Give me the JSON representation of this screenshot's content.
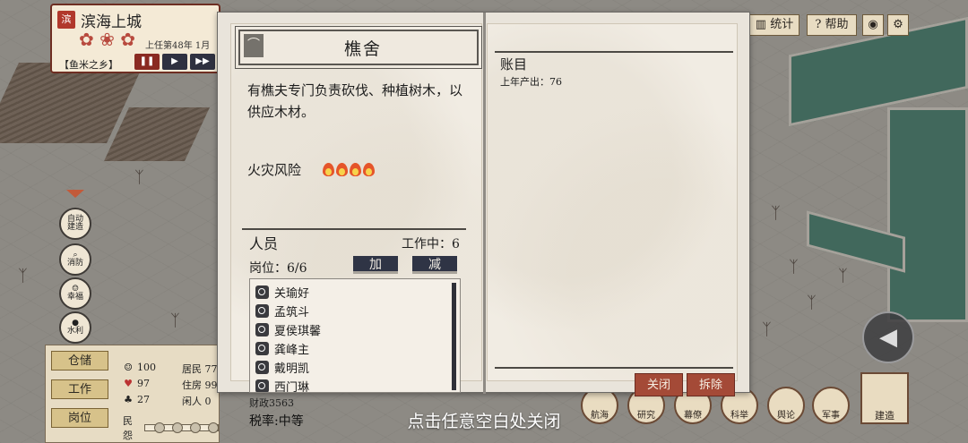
{
  "city": {
    "name": "滨海上城",
    "seal": "滨",
    "term": "上任第48年 1月",
    "tag": "【鱼米之乡】",
    "speed": [
      "❚❚",
      "▶",
      "▶▶"
    ]
  },
  "left_tools": [
    {
      "label": "自动\n建造"
    },
    {
      "label": "消防"
    },
    {
      "label": "幸福"
    },
    {
      "label": "水利"
    }
  ],
  "bottom_left": {
    "buttons": [
      "仓储",
      "工作",
      "岗位"
    ],
    "stats": [
      {
        "icon": "☺",
        "value": "100"
      },
      {
        "icon": "♥",
        "value": "97"
      },
      {
        "icon": "♣",
        "value": "27"
      }
    ],
    "stats_right": [
      "居民 77",
      "住房 99",
      "闲人 0"
    ],
    "mood_label": "民怨"
  },
  "finance": {
    "label": "财政3563",
    "tax": "税率:中等"
  },
  "top_right": {
    "stats": "统计",
    "help": "帮助",
    "eye": "◉",
    "gear": "⚙"
  },
  "bottom_bar": [
    {
      "label": "航海"
    },
    {
      "label": "研究"
    },
    {
      "label": "幕僚"
    },
    {
      "label": "科举"
    },
    {
      "label": "舆论"
    },
    {
      "label": "军事"
    }
  ],
  "build": "建造",
  "nav_arrow": "◀",
  "close_hint": "点击任意空白处关闭",
  "building": {
    "title": "樵舍",
    "description": "有樵夫专门负责砍伐、种植树木，以供应木材。",
    "fire_risk_label": "火灾风险",
    "fire_risk_level": 4,
    "staff_title": "人员",
    "working_label": "工作中：6",
    "slots_label": "岗位：6/6",
    "add_label": "加",
    "remove_label": "减",
    "staff": [
      "关瑜好",
      "孟筑斗",
      "夏侯琪馨",
      "龚峰主",
      "戴明凯",
      "西门琳"
    ]
  },
  "ledger": {
    "title": "账目",
    "items": [
      "上年产出：76"
    ],
    "close_label": "关闭",
    "demolish_label": "拆除"
  }
}
